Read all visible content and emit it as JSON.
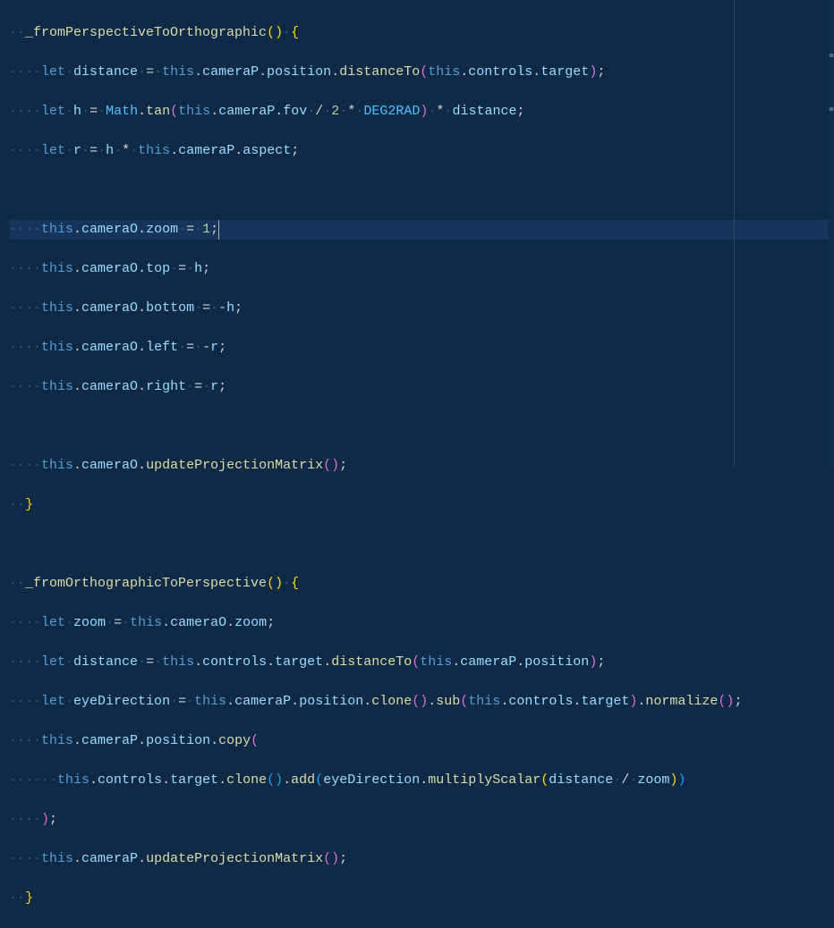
{
  "editor": {
    "language": "javascript",
    "currentLine": 6,
    "tokens": {
      "fn1": "_fromPerspectiveToOrthographic",
      "fn2": "_fromOrthographicToPerspective",
      "let": "let",
      "this": "this",
      "distance": "distance",
      "cameraP": "cameraP",
      "cameraO": "cameraO",
      "position": "position",
      "distanceTo": "distanceTo",
      "controls": "controls",
      "target": "target",
      "h": "h",
      "Math": "Math",
      "tan": "tan",
      "fov": "fov",
      "DEG2RAD": "DEG2RAD",
      "r": "r",
      "aspect": "aspect",
      "zoom": "zoom",
      "top": "top",
      "bottom": "bottom",
      "left": "left",
      "right": "right",
      "updateProjectionMatrix": "updateProjectionMatrix",
      "eyeDirection": "eyeDirection",
      "clone": "clone",
      "sub": "sub",
      "normalize": "normalize",
      "copy": "copy",
      "add": "add",
      "multiplyScalar": "multiplyScalar",
      "num1": "1",
      "num2": "2"
    },
    "ws": {
      "ind2": "··",
      "ind4": "····",
      "ind6": "······",
      "sp": "·"
    },
    "ops": {
      "assign": "=",
      "mul": "*",
      "div": "/",
      "neg": "-",
      "dot": ".",
      "semi": ";",
      "comma": ","
    }
  }
}
